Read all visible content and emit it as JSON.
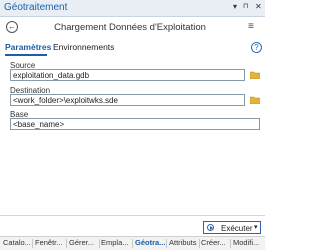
{
  "titlebar": {
    "title": "Géotraitement",
    "pin": "▾",
    "pin2": "📌",
    "close": "✕"
  },
  "header": {
    "back": "←",
    "title": "Chargement Données d'Exploitation",
    "menu": "≡"
  },
  "tabs": {
    "parameters": "Paramètres",
    "environments": "Environnements",
    "help": "?"
  },
  "fields": {
    "source": {
      "label": "Source",
      "value": "exploitation_data.gdb"
    },
    "destination": {
      "label": "Destination",
      "value": "<work_folder>\\exploitwks.sde"
    },
    "base": {
      "label": "Base",
      "value": "<base_name>"
    }
  },
  "run": {
    "label": "Exécuter",
    "dropdown": "▾"
  },
  "pane_tabs": [
    "Catalo...",
    "Fenêtr...",
    "Gérer...",
    "Empla...",
    "Géotra...",
    "Attributs",
    "Créer...",
    "Modifi..."
  ],
  "colors": {
    "accent": "#1c5fa6",
    "folder": "#e3b33b"
  }
}
